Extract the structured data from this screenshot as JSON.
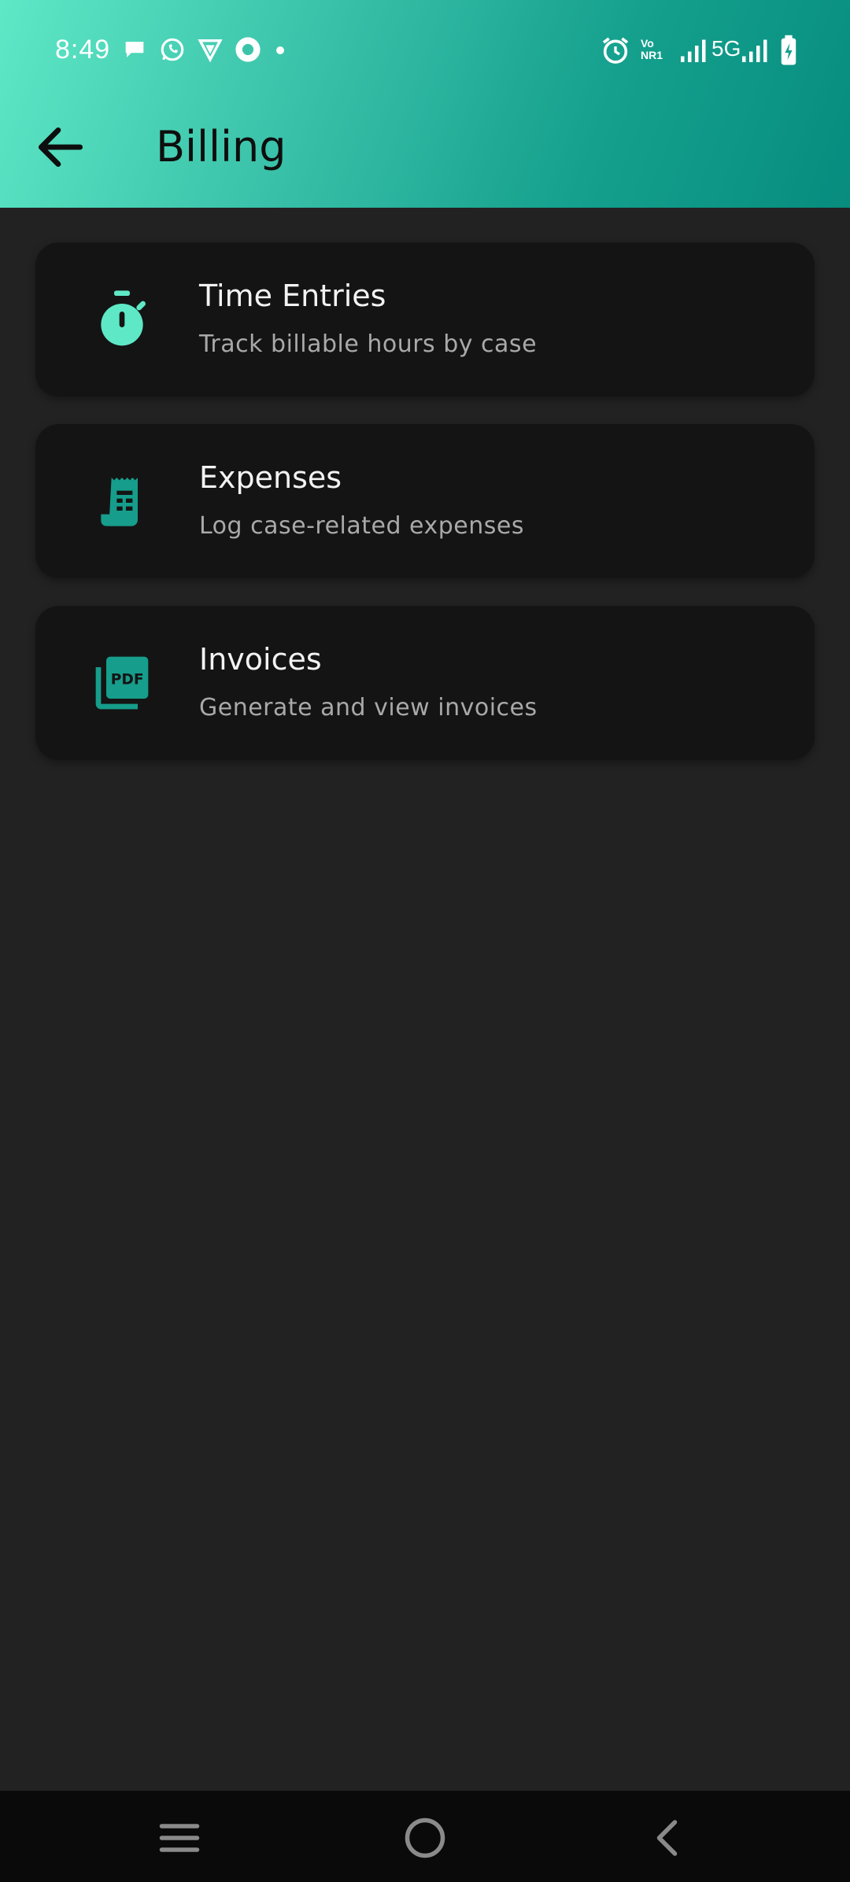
{
  "status_bar": {
    "time": "8:49",
    "vonr_line1": "Vo",
    "vonr_line2": "NR1",
    "network": "5G",
    "notification_icons": [
      "chat-bubble-icon",
      "whatsapp-icon",
      "vpn-shield-icon",
      "circle-app-icon",
      "dot-icon"
    ],
    "system_icons": [
      "alarm-icon",
      "vonr-icon",
      "signal-icon",
      "signal-icon",
      "battery-charging-icon"
    ]
  },
  "header": {
    "title": "Billing",
    "back_icon": "arrow-left-icon",
    "gradient_colors": [
      "#5ee8c6",
      "#078c7e"
    ]
  },
  "cards": [
    {
      "title": "Time Entries",
      "subtitle": "Track billable hours by case",
      "icon": "stopwatch-icon",
      "icon_color": "#5ee8c6"
    },
    {
      "title": "Expenses",
      "subtitle": "Log case-related expenses",
      "icon": "receipt-icon",
      "icon_color": "#169d8b"
    },
    {
      "title": "Invoices",
      "subtitle": "Generate and view invoices",
      "icon": "pdf-icon",
      "icon_color": "#169d8b",
      "icon_text": "PDF"
    }
  ],
  "nav_bar": {
    "items": [
      "menu-icon",
      "home-icon",
      "back-icon"
    ]
  },
  "colors": {
    "background": "#222222",
    "card": "#141414",
    "accent": "#5ee8c6",
    "accent_dark": "#169d8b"
  }
}
